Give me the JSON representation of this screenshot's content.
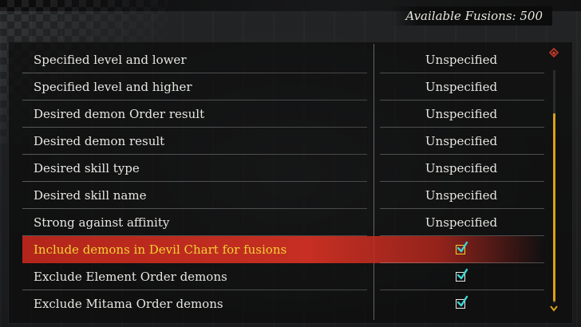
{
  "header": {
    "fusions_label": "Available Fusions:",
    "fusions_count": "500"
  },
  "options": [
    {
      "label": "Specified level and lower",
      "value": "Unspecified",
      "type": "select"
    },
    {
      "label": "Specified level and higher",
      "value": "Unspecified",
      "type": "select"
    },
    {
      "label": "Desired demon Order result",
      "value": "Unspecified",
      "type": "select"
    },
    {
      "label": "Desired demon result",
      "value": "Unspecified",
      "type": "select"
    },
    {
      "label": "Desired skill type",
      "value": "Unspecified",
      "type": "select"
    },
    {
      "label": "Desired skill name",
      "value": "Unspecified",
      "type": "select"
    },
    {
      "label": "Strong against affinity",
      "value": "Unspecified",
      "type": "select"
    },
    {
      "label": "Include demons in Devil Chart for fusions",
      "value": "checked",
      "type": "checkbox",
      "selected": true
    },
    {
      "label": "Exclude Element Order demons",
      "value": "checked",
      "type": "checkbox"
    },
    {
      "label": "Exclude Mitama Order demons",
      "value": "checked",
      "type": "checkbox"
    }
  ],
  "scrollbar": {
    "position_fraction": 1.0
  },
  "colors": {
    "highlight": "#c62f22",
    "highlight_text": "#f1d233",
    "scroll_thumb": "#d9a118",
    "check": "#3bd6d2"
  },
  "icons": {
    "scroll_up": "diamond-arrow-up-icon",
    "scroll_down": "arrow-down-icon",
    "checkbox": "checkmark-icon"
  }
}
